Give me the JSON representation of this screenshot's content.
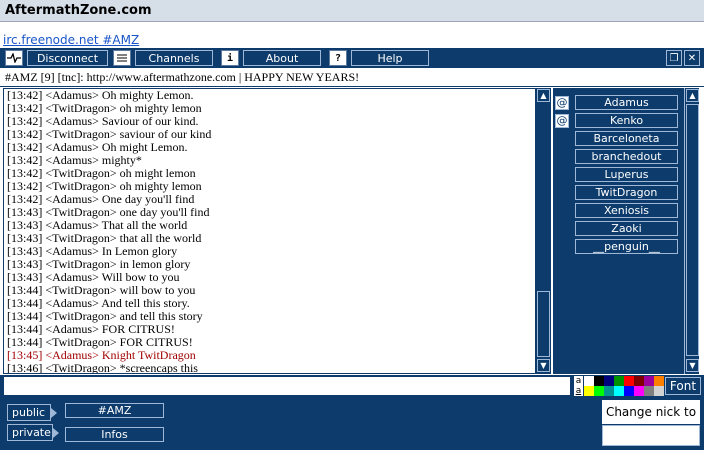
{
  "site": {
    "title": "AftermathZone.com"
  },
  "server_link": "irc.freenode.net #AMZ",
  "toolbar": {
    "disconnect": {
      "label": "Disconnect",
      "icon": "disconnect-icon"
    },
    "channels": {
      "label": "Channels",
      "icon": "list-icon"
    },
    "about": {
      "label": "About",
      "icon": "info-icon",
      "glyph": "i"
    },
    "help": {
      "label": "Help",
      "icon": "help-icon",
      "glyph": "?"
    },
    "window_buttons": [
      {
        "name": "restore-window",
        "glyph": "❐"
      },
      {
        "name": "close-window",
        "glyph": "✕"
      }
    ]
  },
  "topic": "#AMZ [9] [tnc]: http://www.aftermathzone.com | HAPPY NEW YEARS!",
  "messages": [
    "[13:42] <Adamus> Oh mighty Lemon.",
    "[13:42] <TwitDragon> oh mighty lemon",
    "[13:42] <Adamus> Saviour of our kind.",
    "[13:42] <TwitDragon> saviour of our kind",
    "[13:42] <Adamus> Oh might Lemon.",
    "[13:42] <Adamus> mighty*",
    "[13:42] <TwitDragon> oh might lemon",
    "[13:42] <TwitDragon> oh mighty lemon",
    "[13:42] <Adamus> One day you'll find",
    "[13:43] <TwitDragon> one day you'll find",
    "[13:43] <Adamus> That all the world",
    "[13:43] <TwitDragon> that all the world",
    "[13:43] <Adamus> In Lemon glory",
    "[13:43] <TwitDragon> in lemon glory",
    "[13:43] <Adamus> Will bow to you",
    "[13:44] <TwitDragon> will bow to you",
    "[13:44] <Adamus> And tell this story.",
    "[13:44] <TwitDragon> and tell this story",
    "[13:44] <Adamus> FOR CITRUS!",
    "[13:44] <TwitDragon> FOR CITRUS!",
    "[13:45] <Adamus> Knight TwitDragon",
    "[13:46] <TwitDragon> *screencaps this"
  ],
  "highlight_index": 20,
  "highlight_color": "#a00000",
  "users": [
    {
      "nick": "Adamus",
      "op": true
    },
    {
      "nick": "Kenko",
      "op": true
    },
    {
      "nick": "Barceloneta",
      "op": false
    },
    {
      "nick": "branchedout",
      "op": false
    },
    {
      "nick": "Luperus",
      "op": false
    },
    {
      "nick": "TwitDragon",
      "op": false
    },
    {
      "nick": "Xeniosis",
      "op": false
    },
    {
      "nick": "Zaoki",
      "op": false
    },
    {
      "nick": "__penguin__",
      "op": false
    }
  ],
  "op_glyph": "@",
  "input": {
    "value": "",
    "font_label": "Font",
    "format_glyph": "a"
  },
  "palette": {
    "row1": [
      "#ffffff",
      "#000000",
      "#00007f",
      "#009300",
      "#ff0000",
      "#7f0000",
      "#9c009c",
      "#fc7f00"
    ],
    "row2": [
      "#ffff00",
      "#00fc00",
      "#009393",
      "#00ffff",
      "#0000fc",
      "#ff00ff",
      "#7f7f7f",
      "#d2d2d2"
    ]
  },
  "bottom": {
    "public_label": "public",
    "private_label": "private",
    "channel_tab": "#AMZ",
    "info_tab": "Infos",
    "nick_label": "Change nick to",
    "nick_value": ""
  },
  "colors": {
    "panel": "#0c3b6c",
    "border": "#9fb8d8",
    "link": "#1a55c8"
  }
}
